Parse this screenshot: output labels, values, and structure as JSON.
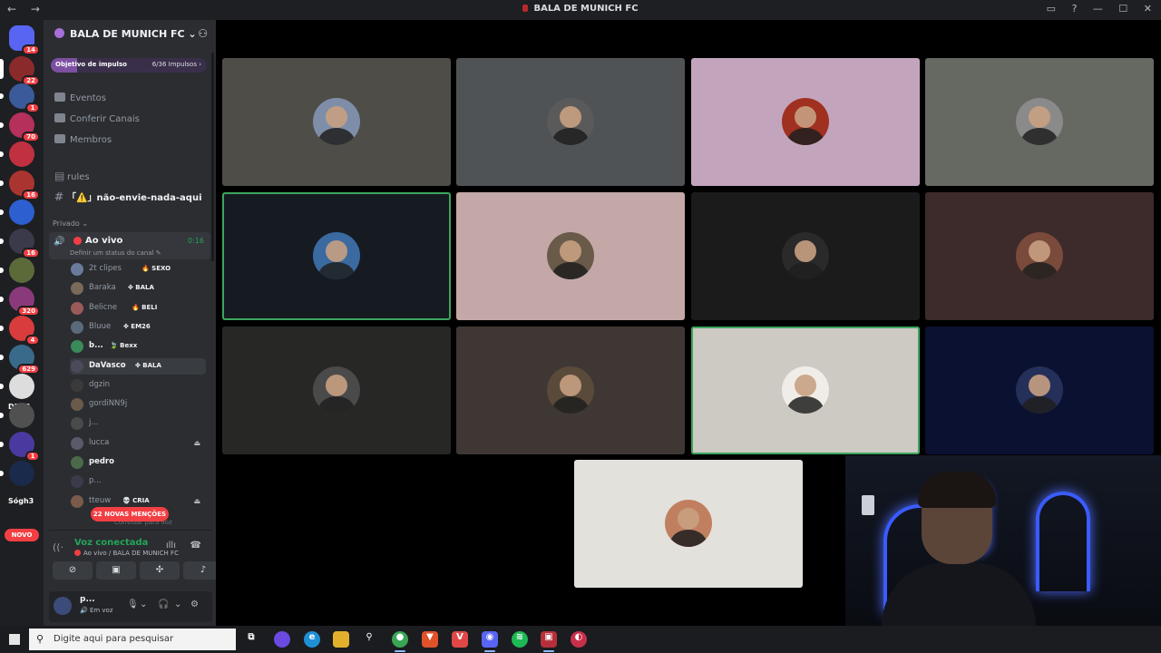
{
  "window": {
    "title": "BALA DE MUNICH FC",
    "nav_glyphs": "← →",
    "controls": [
      "▭",
      "?",
      "—",
      "☐",
      "✕"
    ]
  },
  "rail": {
    "servers": [
      {
        "color": "#5865f2",
        "badge": "14"
      },
      {
        "color": "#8a2a2a",
        "badge": "22"
      },
      {
        "color": "#3a5a9a",
        "badge": "1"
      },
      {
        "color": "#b5305a",
        "badge": "70"
      },
      {
        "color": "#c03040",
        "badge": ""
      },
      {
        "color": "#aa3530",
        "badge": "16"
      },
      {
        "color": "#2d5fd0",
        "badge": ""
      },
      {
        "color": "#3a3a4a",
        "badge": "16"
      },
      {
        "color": "#5c6a3a",
        "badge": ""
      },
      {
        "color": "#8a3a7a",
        "badge": "320"
      },
      {
        "color": "#d83c3c",
        "badge": "4"
      },
      {
        "color": "#3a6a8a",
        "badge": "629"
      },
      {
        "color": "#dddddd",
        "badge": ""
      },
      {
        "color": "#505050",
        "badge": ""
      },
      {
        "color": "#4a3aa0",
        "badge": "1"
      },
      {
        "color": "#1a2a4a",
        "badge": ""
      }
    ],
    "labels": [
      "DEUS",
      "Sógh3"
    ],
    "novo_label": "NOVO"
  },
  "sidebar": {
    "server_name": "BALA DE MUNICH FC ⌄",
    "boost": {
      "label": "Objetivo de impulso",
      "progress": "6/36 Impulsos ›",
      "fraction": 0.167
    },
    "menu": [
      "Eventos",
      "Conferir Canais",
      "Membros"
    ],
    "channels": [
      {
        "name": "rules",
        "icon": "rules-icon"
      },
      {
        "name": "「⚠️」não-envie-nada-aqui",
        "icon": "hash-icon"
      }
    ],
    "category": "Privado ⌄",
    "voice_channel": {
      "name": "Ao vivo",
      "time": "0:16",
      "status": "Definir um status do canal ✎"
    },
    "members": [
      {
        "name": "2t clipes",
        "tag": "🔥 SEXO",
        "bright": false,
        "color": "#6a7a9a"
      },
      {
        "name": "Baraka",
        "tag": "✤ BALA",
        "bright": false,
        "color": "#7a6a5a"
      },
      {
        "name": "Belicne",
        "tag": "🔥 BELI",
        "bright": false,
        "color": "#9a5a5a"
      },
      {
        "name": "Bluue",
        "tag": "✤ EM26",
        "bright": false,
        "color": "#5a6a7a"
      },
      {
        "name": "b...",
        "tag": "🍃 Bexx",
        "bright": true,
        "color": "#3a8a5a"
      },
      {
        "name": "DaVasco",
        "tag": "✤ BALA",
        "bright": true,
        "color": "#4a4a5a"
      },
      {
        "name": "dgzin",
        "tag": "",
        "bright": false,
        "color": "#3a3a3a"
      },
      {
        "name": "gordiNN9j",
        "tag": "",
        "bright": false,
        "color": "#6a5a4a"
      },
      {
        "name": "j...",
        "tag": "",
        "bright": false,
        "color": "#4a4a4a"
      },
      {
        "name": "lucca",
        "tag": "",
        "bright": false,
        "color": "#5a5a6a"
      },
      {
        "name": "pedro",
        "tag": "",
        "bright": true,
        "color": "#4a6a4a"
      },
      {
        "name": "p...",
        "tag": "",
        "bright": false,
        "color": "#3a3a4a"
      },
      {
        "name": "tteuw",
        "tag": "💀 CRIA",
        "bright": false,
        "color": "#7a5a4a"
      }
    ],
    "mentions": "22 NOVAS MENÇÕES",
    "invite_text": "Convidar para voz",
    "voice_panel": {
      "status": "Voz conectada",
      "channel": "Ao vivo / BALA DE MUNICH FC"
    },
    "user": {
      "name": "p...",
      "status": "🔊 Em voz"
    }
  },
  "stage": {
    "tiles": [
      {
        "bg": "#4f4d48",
        "speaking": false,
        "face": "#7e8ea8"
      },
      {
        "bg": "#505356",
        "speaking": false,
        "face": "#5a5a5a"
      },
      {
        "bg": "#c2a5bd",
        "speaking": false,
        "face": "#a03020"
      },
      {
        "bg": "#666862",
        "speaking": false,
        "face": "#8a8a8a"
      },
      {
        "bg": "#161b22",
        "speaking": true,
        "face": "#3a6aa0"
      },
      {
        "bg": "#c4a8a8",
        "speaking": false,
        "face": "#6a5a4a"
      },
      {
        "bg": "#1b1b1b",
        "speaking": false,
        "face": "#2a2a2a"
      },
      {
        "bg": "#3d2b2b",
        "speaking": false,
        "face": "#7a4a3a"
      },
      {
        "bg": "#272725",
        "speaking": false,
        "face": "#4a4a4a"
      },
      {
        "bg": "#3e3734",
        "speaking": false,
        "face": "#5a4a3a"
      },
      {
        "bg": "#cdc9c3",
        "speaking": true,
        "face": "#f0ede8"
      },
      {
        "bg": "#0b1130",
        "speaking": false,
        "face": "#24305a"
      },
      {
        "bg": "#e3e1dc",
        "speaking": false,
        "face": "#c08060"
      }
    ]
  },
  "taskbar": {
    "search_placeholder": "Digite aqui para pesquisar",
    "apps": [
      {
        "name": "task-view-icon",
        "color": "#1b1c20",
        "glyph": "⧉"
      },
      {
        "name": "copilot-icon",
        "color": "#6a4ae0",
        "glyph": ""
      },
      {
        "name": "edge-icon",
        "color": "#1f8fd6",
        "glyph": "e"
      },
      {
        "name": "file-explorer-icon",
        "color": "#e3b02e",
        "glyph": ""
      },
      {
        "name": "pin-icon",
        "color": "#1b1c20",
        "glyph": "⚲"
      },
      {
        "name": "chrome-icon",
        "color": "#3aa655",
        "glyph": "●"
      },
      {
        "name": "brave-icon",
        "color": "#e0522a",
        "glyph": "▼"
      },
      {
        "name": "vivaldi-icon",
        "color": "#e04848",
        "glyph": "V"
      },
      {
        "name": "discord-icon",
        "color": "#5865f2",
        "glyph": "◉"
      },
      {
        "name": "spotify-icon",
        "color": "#1db954",
        "glyph": "≋"
      },
      {
        "name": "voicemeeter-icon",
        "color": "#b5303a",
        "glyph": "▣"
      },
      {
        "name": "app-icon",
        "color": "#c8304a",
        "glyph": "◐"
      }
    ]
  },
  "colors": {
    "accent_green": "#23a55a",
    "mention_red": "#f23f43",
    "sidebar_bg": "#2b2d31",
    "rail_bg": "#1e1f22"
  }
}
